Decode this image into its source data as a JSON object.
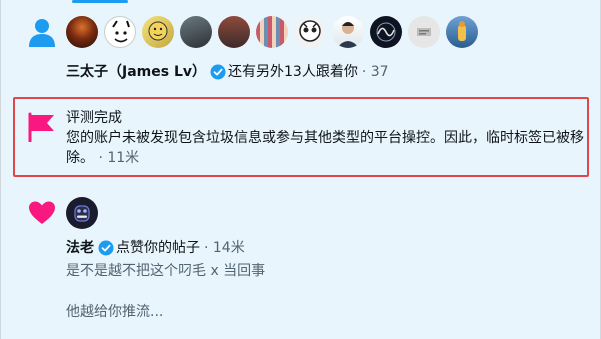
{
  "colors": {
    "background": "#e8f5fd",
    "accent": "#1d9bf0",
    "muted": "#536471",
    "highlight_border": "#e0464b",
    "flag": "#f91880",
    "heart": "#f91880"
  },
  "notification_follow": {
    "icon": "person-icon",
    "name": "三太子（James Lv）",
    "action": "还有另外13人跟着你",
    "time": "· 37",
    "avatar_count": 11
  },
  "notification_review": {
    "icon": "flag-icon",
    "title": "评测完成",
    "body": "您的账户未被发现包含垃圾信息或参与其他类型的平台操控。因此，临时标签已被移除。",
    "time": "· 11米"
  },
  "notification_like": {
    "icon": "heart-icon",
    "name": "法老",
    "action": "点赞你的帖子",
    "time": "· 14米",
    "post_line1": "是不是越不把这个叼毛 x 当回事",
    "post_line2": "他越给你推流..."
  }
}
